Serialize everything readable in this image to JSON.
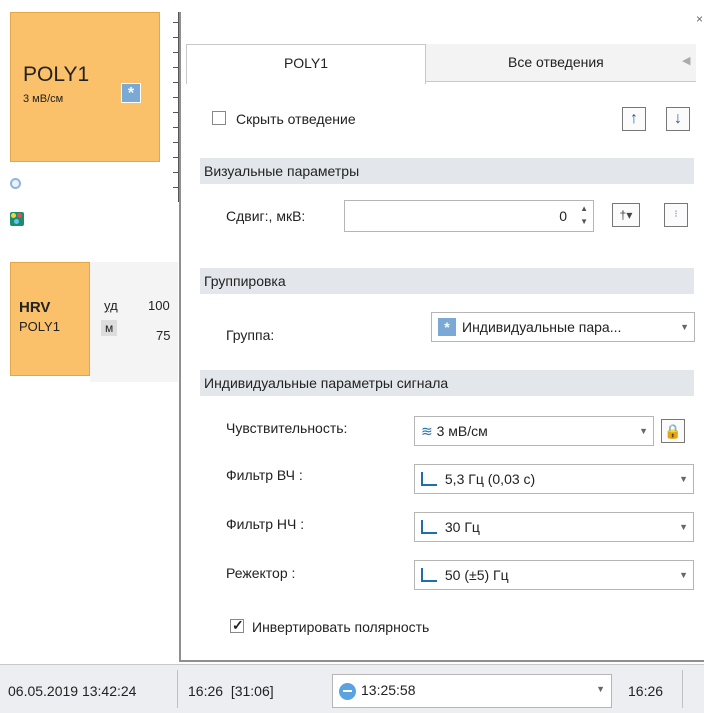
{
  "left": {
    "channel_card": {
      "name": "POLY1",
      "scale": "3 мВ/см"
    },
    "hrv_card": {
      "title": "HRV",
      "subtitle": "POLY1"
    },
    "hrv_units": {
      "unit1": "уд",
      "unit2": "м"
    },
    "hrv_values": {
      "v1": "100",
      "v2": "75"
    }
  },
  "panel": {
    "close": "×",
    "tabs": [
      {
        "label": "POLY1"
      },
      {
        "label": "Все отведения"
      }
    ],
    "hide_lead": {
      "label": "Скрыть отведение",
      "checked": false
    },
    "arrows": {
      "up": "↑",
      "down": "↓"
    },
    "visual_section": "Визуальные параметры",
    "shift": {
      "label": "Сдвиг:, мкВ:",
      "value": "0"
    },
    "grouping_section": "Группировка",
    "group": {
      "label": "Группа:",
      "value": "Индивидуальные  пара..."
    },
    "individual_section": "Индивидуальные параметры сигнала",
    "sensitivity": {
      "label": "Чувствительность:",
      "value": "3 мВ/см"
    },
    "hp_filter": {
      "label": "Фильтр ВЧ :",
      "value": "5,3 Гц (0,03 с)"
    },
    "lp_filter": {
      "label": "Фильтр НЧ :",
      "value": "30 Гц"
    },
    "notch": {
      "label": "Режектор :",
      "value": "50 (±5) Гц"
    },
    "invert": {
      "label": "Инвертировать полярность",
      "checked": true
    }
  },
  "status": {
    "datetime": "06.05.2019 13:42:24",
    "position": "16:26  [31:06]",
    "time": "13:25:58",
    "end": "16:26"
  }
}
